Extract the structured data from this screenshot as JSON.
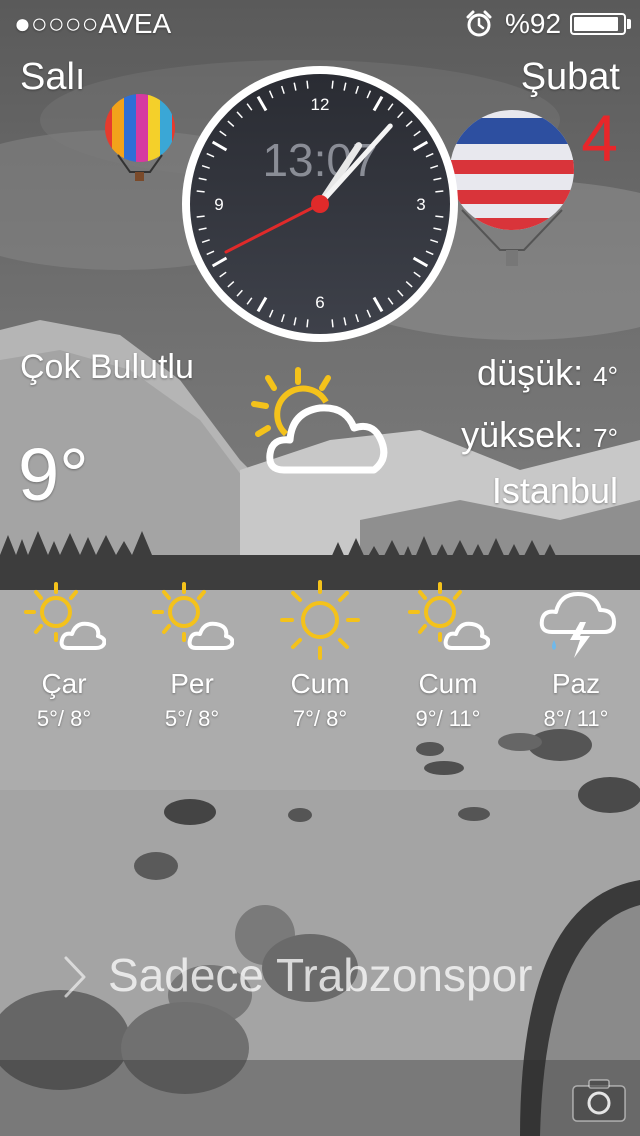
{
  "status_bar": {
    "carrier": "●○○○○AVEA",
    "battery_percent": "%92",
    "battery_level": 0.92,
    "alarm_icon": "alarm-clock-icon"
  },
  "date": {
    "weekday": "Salı",
    "month": "Şubat",
    "day_number": "4"
  },
  "clock": {
    "digital_time": "13:07",
    "dial_labels": [
      "12",
      "3",
      "6",
      "9"
    ]
  },
  "weather": {
    "condition": "Çok Bulutlu",
    "temperature": "9°",
    "low_label": "düşük:",
    "low_value": "4°",
    "high_label": "yüksek:",
    "high_value": "7°",
    "city": "Istanbul",
    "icon": "partly-cloudy-icon"
  },
  "forecast": [
    {
      "day": "Çar",
      "range": "5°/ 8°",
      "icon": "sun-cloud-icon"
    },
    {
      "day": "Per",
      "range": "5°/ 8°",
      "icon": "sun-cloud-icon"
    },
    {
      "day": "Cum",
      "range": "7°/ 8°",
      "icon": "sun-icon"
    },
    {
      "day": "Cum",
      "range": "9°/ 11°",
      "icon": "sun-cloud-icon"
    },
    {
      "day": "Paz",
      "range": "8°/ 11°",
      "icon": "thunderstorm-icon"
    }
  ],
  "lockscreen": {
    "slide_text": "Sadece Trabzonspor",
    "camera_icon": "camera-icon"
  },
  "colors": {
    "accent_red": "#e8262a",
    "sun_yellow": "#f4c21b"
  }
}
